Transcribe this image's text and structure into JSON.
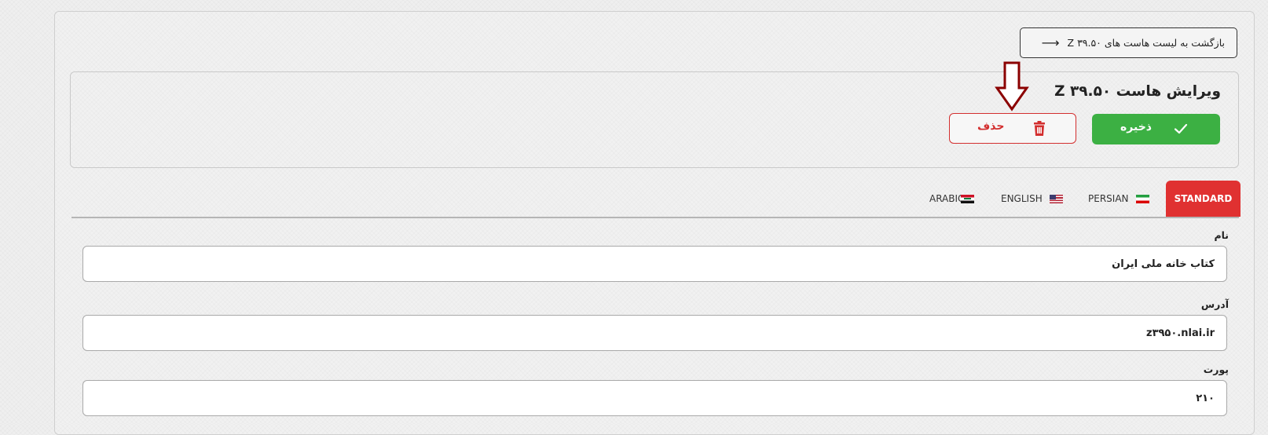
{
  "header": {
    "back_label": "بازگشت به لیست هاست های Z ۳۹.۵۰",
    "title": "ویرایش هاست Z ۳۹.۵۰"
  },
  "actions": {
    "save_label": "ذخیره",
    "delete_label": "حذف"
  },
  "tabs": [
    {
      "label": "STANDARD",
      "active": true
    },
    {
      "label": "PERSIAN",
      "flag": "iran-flag-icon"
    },
    {
      "label": "ENGLISH",
      "flag": "usa-flag-icon"
    },
    {
      "label": "ARABIC",
      "flag": "iraq-flag-icon"
    }
  ],
  "form": {
    "name": {
      "label": "نام",
      "value": "کتاب خانه ملی ایران"
    },
    "address": {
      "label": "آدرس",
      "value": "z۳۹۵۰.nlai.ir"
    },
    "port": {
      "label": "پورت",
      "value": "۲۱۰"
    }
  },
  "colors": {
    "save": "#3cb043",
    "delete": "#d32f2f",
    "active_tab": "#e03131",
    "annotation_arrow": "#8b0000"
  },
  "annotation": {
    "icon": "down-arrow-icon"
  }
}
